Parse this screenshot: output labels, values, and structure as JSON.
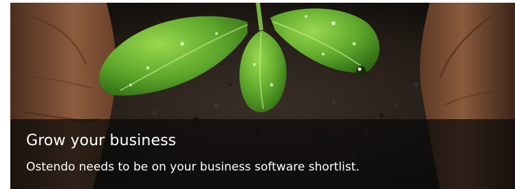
{
  "banner": {
    "title": "Grow your business",
    "subtitle": "Ostendo needs to be on your business software shortlist."
  },
  "image": {
    "subject": "seedling-in-hands",
    "colors": {
      "leaf": "#5fa82c",
      "leaf_highlight": "#8fd24a",
      "soil": "#2a211b",
      "skin": "#8a5a3c",
      "caption_bg": "#0a0a0a"
    }
  }
}
